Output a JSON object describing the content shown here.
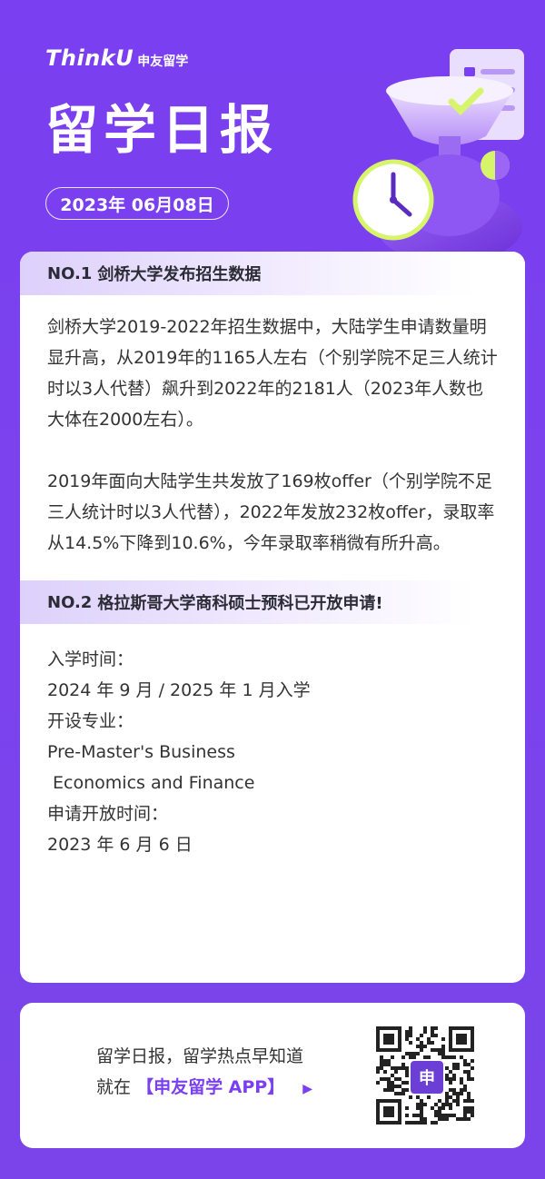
{
  "header": {
    "logo_brand": "ThinkU",
    "logo_cn": "申友留学",
    "title": "留学日报",
    "date": "2023年 06月08日"
  },
  "section1": {
    "num": "NO.1",
    "title": "剑桥大学发布招生数据",
    "paragraphs": [
      "剑桥大学2019-2022年招生数据中，大陆学生申请数量明显升高，从2019年的1165人左右（个别学院不足三人统计时以3人代替）飙升到2022年的2181人（2023年人数也大体在2000左右）。",
      "2019年面向大陆学生共发放了169枚offer（个别学院不足三人统计时以3人代替），2022年发放232枚offer，录取率从14.5%下降到10.6%，今年录取率稍微有所升高。"
    ]
  },
  "section2": {
    "num": "NO.2",
    "title": "格拉斯哥大学商科硕士预科已开放申请!",
    "lines": [
      "入学时间：",
      "2024 年 9 月 / 2025 年 1 月入学",
      "开设专业：",
      "Pre-Master's Business",
      " Economics and Finance",
      "申请开放时间：",
      "2023 年 6 月 6 日"
    ]
  },
  "promo": {
    "line1": "留学日报，留学热点早知道",
    "line2_prefix": "就在",
    "app_name": "【申友留学 APP】",
    "arrow": "▶",
    "qr_badge": "申"
  },
  "colors": {
    "brand_purple": "#7a3ff0",
    "accent_yellow": "#d6f56a"
  },
  "icons": [
    "clock-icon",
    "hourglass-illustration",
    "checklist-icon",
    "qr-code"
  ]
}
